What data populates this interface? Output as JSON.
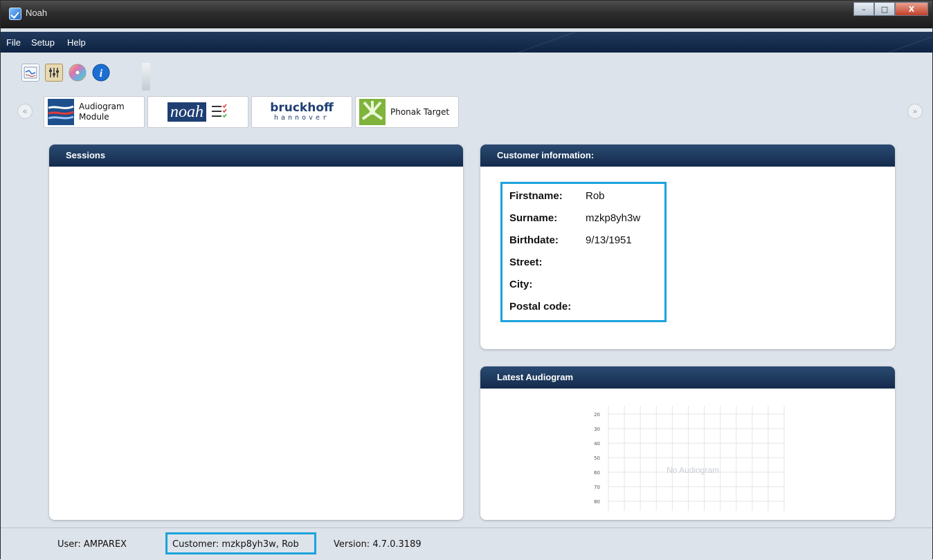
{
  "window": {
    "title": "Noah",
    "minimize": "–",
    "maximize": "□",
    "close": "X"
  },
  "menu": [
    "File",
    "Setup",
    "Help"
  ],
  "toolbar": {
    "icons": [
      "audiogram-chart-icon",
      "settings-sliders-icon",
      "cd-disc-icon",
      "info-icon"
    ]
  },
  "modules": [
    {
      "label_line1": "Audiogram",
      "label_line2": "Module"
    },
    {
      "brand": "noah"
    },
    {
      "brand": "bruckhoff",
      "sub": "hannover"
    },
    {
      "label": "Phonak Target"
    }
  ],
  "sessions": {
    "title": "Sessions"
  },
  "customer_info": {
    "title": "Customer information:",
    "rows": [
      {
        "label": "Firstname:",
        "value": "Rob"
      },
      {
        "label": "Surname:",
        "value": "mzkp8yh3w"
      },
      {
        "label": "Birthdate:",
        "value": "9/13/1951"
      },
      {
        "label": "Street:",
        "value": ""
      },
      {
        "label": "City:",
        "value": ""
      },
      {
        "label": "Postal code:",
        "value": ""
      }
    ]
  },
  "audiogram": {
    "title": "Latest Audiogram",
    "empty_text": "No Audiogram",
    "y_ticks": [
      "20",
      "30",
      "40",
      "50",
      "60",
      "70",
      "80"
    ]
  },
  "status": {
    "user": "User:  AMPAREX",
    "customer": "Customer:  mzkp8yh3w, Rob",
    "version": "Version:  4.7.0.3189"
  },
  "colors": {
    "accent_highlight": "#1aa3dc",
    "header_navy": "#142b4c",
    "background": "#dde3ea"
  }
}
